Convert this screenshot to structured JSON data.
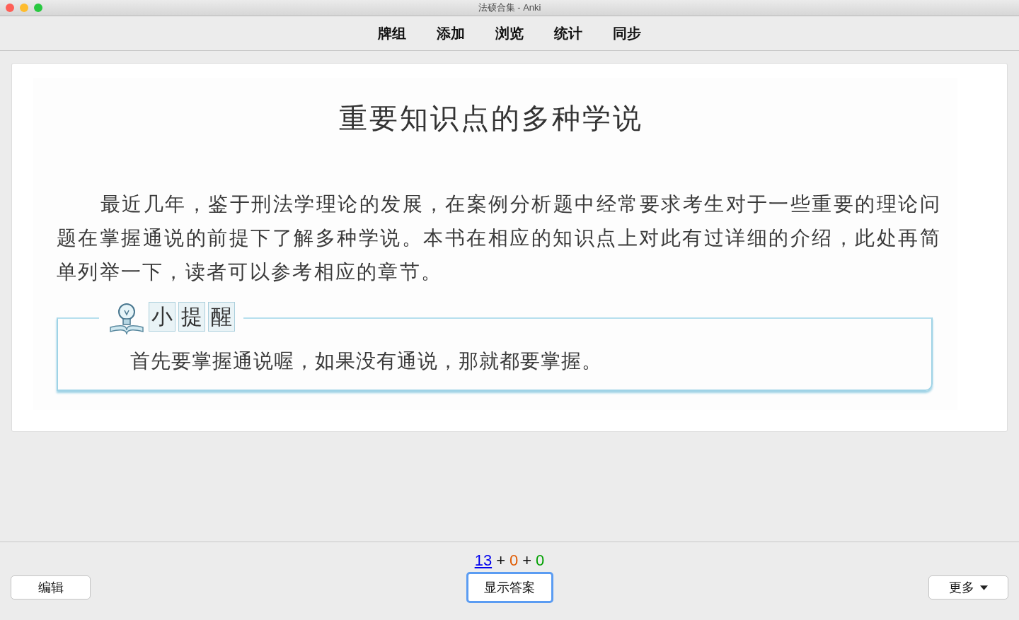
{
  "window": {
    "title": "法硕合集 - Anki"
  },
  "toolbar": [
    {
      "label": "牌组"
    },
    {
      "label": "添加"
    },
    {
      "label": "浏览"
    },
    {
      "label": "统计"
    },
    {
      "label": "同步"
    }
  ],
  "card": {
    "title": "重要知识点的多种学说",
    "paragraph": "最近几年，鉴于刑法学理论的发展，在案例分析题中经常要求考生对于一些重要的理论问题在掌握通说的前提下了解多种学说。本书在相应的知识点上对此有过详细的介绍，此处再简单列举一下，读者可以参考相应的章节。",
    "tip_label": [
      "小",
      "提",
      "醒"
    ],
    "tip_text": "首先要掌握通说喔，如果没有通说，那就都要掌握。"
  },
  "counts": [
    {
      "value": "13",
      "kind": "new"
    },
    {
      "value": "+",
      "kind": "sep"
    },
    {
      "value": "0",
      "kind": "learn"
    },
    {
      "value": "+",
      "kind": "sep"
    },
    {
      "value": "0",
      "kind": "review"
    }
  ],
  "buttons": {
    "left": "编辑",
    "center": {
      "label": "显示答案",
      "focused": true
    },
    "right": "更多"
  }
}
